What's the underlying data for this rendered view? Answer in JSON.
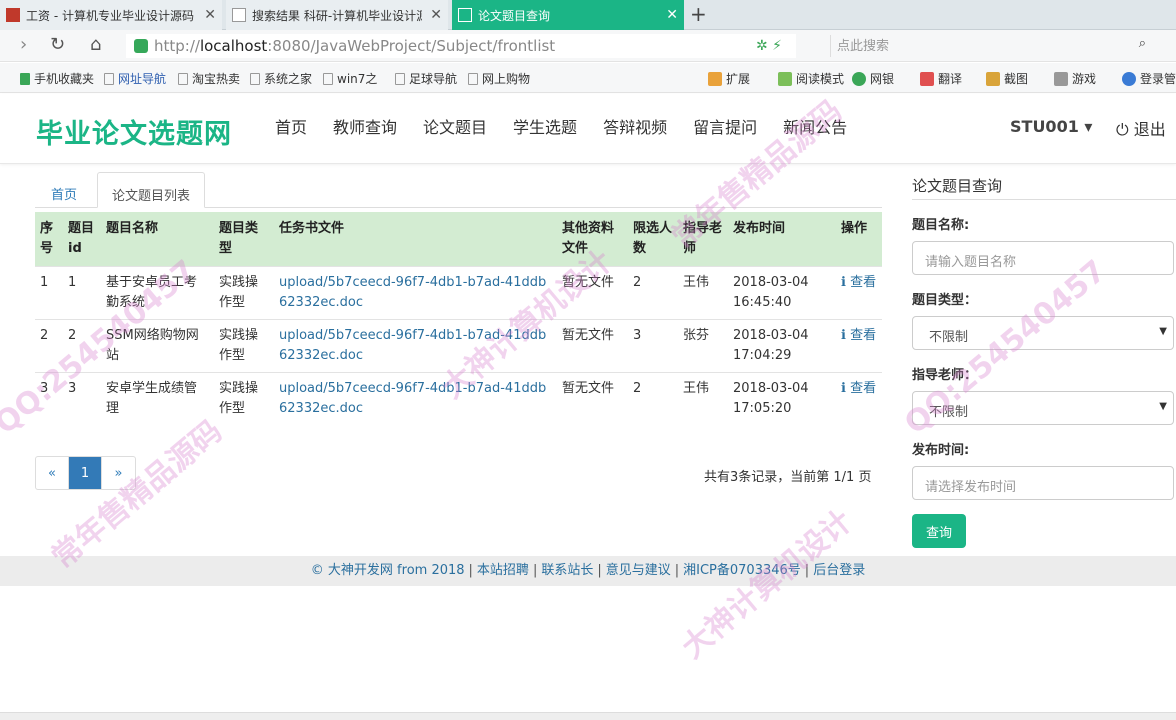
{
  "browser": {
    "tabs": [
      {
        "label": "工资 - 计算机专业毕业设计源码"
      },
      {
        "label": "搜索结果 科研-计算机毕业设计源"
      },
      {
        "label": "论文题目查询"
      }
    ],
    "url_prefix": "http://",
    "url_host": "localhost",
    "url_rest": ":8080/JavaWebProject/Subject/frontlist",
    "search_placeholder": "点此搜索",
    "bookmarks": [
      "手机收藏夹",
      "网址导航",
      "淘宝热卖",
      "系统之家",
      "win7之",
      "足球导航",
      "网上购物"
    ],
    "tools": [
      "扩展",
      "阅读模式",
      "网银",
      "翻译",
      "截图",
      "游戏",
      "登录管"
    ]
  },
  "site": {
    "logo": "毕业论文选题网",
    "nav": [
      "首页",
      "教师查询",
      "论文题目",
      "学生选题",
      "答辩视频",
      "留言提问",
      "新闻公告"
    ],
    "user": "STU001 ▾",
    "logout": "退出"
  },
  "subtabs": {
    "home": "首页",
    "active": "论文题目列表"
  },
  "table": {
    "headers": [
      "序号",
      "题目id",
      "题目名称",
      "题目类型",
      "任务书文件",
      "其他资料文件",
      "限选人数",
      "指导老师",
      "发布时间",
      "操作"
    ],
    "rows": [
      {
        "no": "1",
        "id": "1",
        "name": "基于安卓员工考勤系统",
        "type": "实践操作型",
        "file": "upload/5b7ceecd-96f7-4db1-b7ad-41ddb62332ec.doc",
        "other": "暂无文件",
        "limit": "2",
        "teacher": "王伟",
        "time": "2018-03-04 16:45:40",
        "op": "查看"
      },
      {
        "no": "2",
        "id": "2",
        "name": "SSM网络购物网站",
        "type": "实践操作型",
        "file": "upload/5b7ceecd-96f7-4db1-b7ad-41ddb62332ec.doc",
        "other": "暂无文件",
        "limit": "3",
        "teacher": "张芬",
        "time": "2018-03-04 17:04:29",
        "op": "查看"
      },
      {
        "no": "3",
        "id": "3",
        "name": "安卓学生成绩管理",
        "type": "实践操作型",
        "file": "upload/5b7ceecd-96f7-4db1-b7ad-41ddb62332ec.doc",
        "other": "暂无文件",
        "limit": "2",
        "teacher": "王伟",
        "time": "2018-03-04 17:05:20",
        "op": "查看"
      }
    ]
  },
  "pager": {
    "prev": "«",
    "current": "1",
    "next": "»",
    "info": "共有3条记录，当前第 1/1 页"
  },
  "side": {
    "title": "论文题目查询",
    "name_label": "题目名称:",
    "name_placeholder": "请输入题目名称",
    "type_label": "题目类型：",
    "type_value": "不限制",
    "teacher_label": "指导老师：",
    "teacher_value": "不限制",
    "time_label": "发布时间:",
    "time_placeholder": "请选择发布时间",
    "query_button": "查询"
  },
  "footer": {
    "links": [
      "© 大神开发网 from 2018",
      "本站招聘",
      "联系站长",
      "意见与建议",
      "湘ICP备0703346号",
      "后台登录"
    ]
  },
  "watermark": [
    "QQ:254540457",
    "常年售精品源码",
    "大神计算机设计",
    "大神计算机设计",
    "QQ:254540457",
    "常年售精品源码"
  ],
  "colors": {
    "accent": "#1bb586",
    "header_row": "#d3ecd2",
    "link": "#2a6f9e",
    "pager_active": "#337ab7"
  }
}
